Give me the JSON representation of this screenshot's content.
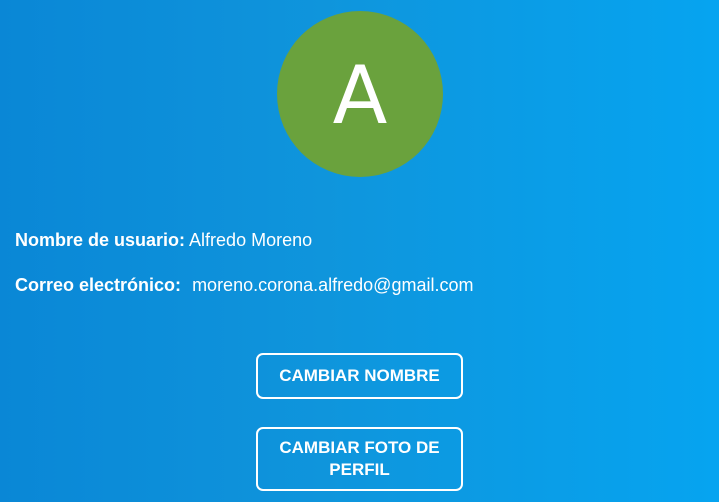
{
  "profile": {
    "avatar_initial": "A",
    "avatar_color": "#6aa23d",
    "username_label": "Nombre de usuario:",
    "username_value": "Alfredo Moreno",
    "email_label": "Correo electrónico:",
    "email_value": "moreno.corona.alfredo@gmail.com"
  },
  "actions": {
    "change_name_label": "CAMBIAR NOMBRE",
    "change_photo_label": "CAMBIAR FOTO DE PERFIL"
  },
  "theme": {
    "background_start": "#0a87d6",
    "background_end": "#06a4f0",
    "text_color": "#ffffff"
  }
}
